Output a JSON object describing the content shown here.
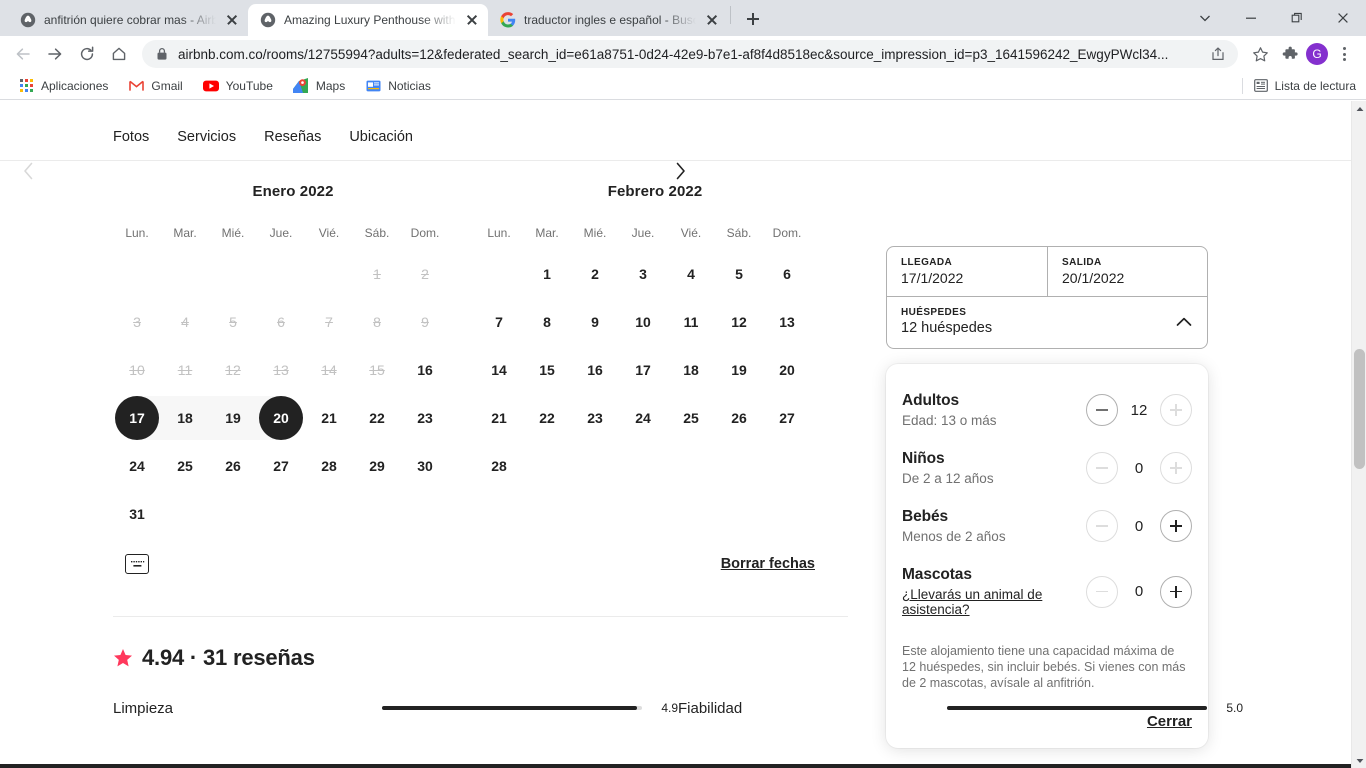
{
  "browser": {
    "tabs": [
      {
        "title": "anfitrión quiere cobrar mas - Airb",
        "favicon": "airbnb-icon",
        "active": false
      },
      {
        "title": "Amazing Luxury Penthouse with P",
        "favicon": "airbnb-icon",
        "active": true
      },
      {
        "title": "traductor ingles e español - Busc",
        "favicon": "google-icon",
        "active": false
      }
    ],
    "new_tab_label": "+",
    "window_controls": [
      "chevron-down",
      "minimize",
      "restore",
      "close"
    ],
    "nav": {
      "back": "←",
      "forward": "→",
      "reload": "⟳",
      "home": "⌂"
    },
    "omnibox": {
      "url": "airbnb.com.co/rooms/12755994?adults=12&federated_search_id=e61a8751-0d24-42e9-b7e1-af8f4d8518ec&source_impression_id=p3_1641596242_EwgyPWcl34...",
      "lock": "lock-icon"
    },
    "toolbar_icons": [
      "share-icon",
      "star-icon",
      "extensions-icon"
    ],
    "avatar_letter": "G",
    "bookmarks": [
      {
        "label": "Aplicaciones",
        "icon": "apps-grid-icon"
      },
      {
        "label": "Gmail",
        "icon": "gmail-icon"
      },
      {
        "label": "YouTube",
        "icon": "youtube-icon"
      },
      {
        "label": "Maps",
        "icon": "maps-icon"
      },
      {
        "label": "Noticias",
        "icon": "news-icon"
      }
    ],
    "reading_list": {
      "label": "Lista de lectura",
      "icon": "reading-list-icon"
    }
  },
  "page": {
    "section_nav": [
      "Fotos",
      "Servicios",
      "Reseñas",
      "Ubicación"
    ],
    "calendar": {
      "prev_label": "‹",
      "next_label": "›",
      "dow": [
        "Lun.",
        "Mar.",
        "Mié.",
        "Jue.",
        "Vié.",
        "Sáb.",
        "Dom."
      ],
      "months": [
        {
          "title": "Enero 2022",
          "lead_blanks": 5,
          "days": [
            {
              "n": 1,
              "state": "disabled"
            },
            {
              "n": 2,
              "state": "disabled"
            },
            {
              "n": 3,
              "state": "disabled"
            },
            {
              "n": 4,
              "state": "disabled"
            },
            {
              "n": 5,
              "state": "disabled"
            },
            {
              "n": 6,
              "state": "disabled"
            },
            {
              "n": 7,
              "state": "disabled"
            },
            {
              "n": 8,
              "state": "disabled"
            },
            {
              "n": 9,
              "state": "disabled"
            },
            {
              "n": 10,
              "state": "disabled"
            },
            {
              "n": 11,
              "state": "disabled"
            },
            {
              "n": 12,
              "state": "disabled"
            },
            {
              "n": 13,
              "state": "disabled"
            },
            {
              "n": 14,
              "state": "disabled"
            },
            {
              "n": 15,
              "state": "disabled"
            },
            {
              "n": 16,
              "state": "available"
            },
            {
              "n": 17,
              "state": "selected-start"
            },
            {
              "n": 18,
              "state": "in-range"
            },
            {
              "n": 19,
              "state": "in-range"
            },
            {
              "n": 20,
              "state": "selected-end"
            },
            {
              "n": 21,
              "state": "available"
            },
            {
              "n": 22,
              "state": "available"
            },
            {
              "n": 23,
              "state": "available"
            },
            {
              "n": 24,
              "state": "available"
            },
            {
              "n": 25,
              "state": "available"
            },
            {
              "n": 26,
              "state": "available"
            },
            {
              "n": 27,
              "state": "available"
            },
            {
              "n": 28,
              "state": "available"
            },
            {
              "n": 29,
              "state": "available"
            },
            {
              "n": 30,
              "state": "available"
            },
            {
              "n": 31,
              "state": "available"
            }
          ]
        },
        {
          "title": "Febrero 2022",
          "lead_blanks": 1,
          "days": [
            {
              "n": 1,
              "state": "available"
            },
            {
              "n": 2,
              "state": "available"
            },
            {
              "n": 3,
              "state": "available"
            },
            {
              "n": 4,
              "state": "available"
            },
            {
              "n": 5,
              "state": "available"
            },
            {
              "n": 6,
              "state": "available"
            },
            {
              "n": 7,
              "state": "available"
            },
            {
              "n": 8,
              "state": "available"
            },
            {
              "n": 9,
              "state": "available"
            },
            {
              "n": 10,
              "state": "available"
            },
            {
              "n": 11,
              "state": "available"
            },
            {
              "n": 12,
              "state": "available"
            },
            {
              "n": 13,
              "state": "available"
            },
            {
              "n": 14,
              "state": "available"
            },
            {
              "n": 15,
              "state": "available"
            },
            {
              "n": 16,
              "state": "available"
            },
            {
              "n": 17,
              "state": "available"
            },
            {
              "n": 18,
              "state": "available"
            },
            {
              "n": 19,
              "state": "available"
            },
            {
              "n": 20,
              "state": "available"
            },
            {
              "n": 21,
              "state": "available"
            },
            {
              "n": 22,
              "state": "available"
            },
            {
              "n": 23,
              "state": "available"
            },
            {
              "n": 24,
              "state": "available"
            },
            {
              "n": 25,
              "state": "available"
            },
            {
              "n": 26,
              "state": "available"
            },
            {
              "n": 27,
              "state": "available"
            },
            {
              "n": 28,
              "state": "available"
            }
          ]
        }
      ],
      "keyboard_icon": "keyboard-icon",
      "clear_dates_label": "Borrar fechas"
    },
    "reviews": {
      "star_icon": "star-icon",
      "rating": "4.94",
      "separator": "·",
      "count_label": "31 reseñas",
      "heading": "4.94 · 31 reseñas",
      "categories": [
        {
          "label": "Limpieza",
          "value": "4.9",
          "pct": 98
        },
        {
          "label": "Fiabilidad",
          "value": "5.0",
          "pct": 100
        }
      ]
    },
    "booking": {
      "checkin_label": "LLEGADA",
      "checkin_value": "17/1/2022",
      "checkout_label": "SALIDA",
      "checkout_value": "20/1/2022",
      "guests_label": "HUÉSPEDES",
      "guests_value": "12 huéspedes",
      "collapse_icon": "chevron-up-icon",
      "guest_types": [
        {
          "name": "Adultos",
          "sub": "Edad: 13 o más",
          "sub_is_link": false,
          "count": "12",
          "minus_disabled": false,
          "plus_disabled": true
        },
        {
          "name": "Niños",
          "sub": "De 2 a 12 años",
          "sub_is_link": false,
          "count": "0",
          "minus_disabled": true,
          "plus_disabled": true
        },
        {
          "name": "Bebés",
          "sub": "Menos de 2 años",
          "sub_is_link": false,
          "count": "0",
          "minus_disabled": true,
          "plus_disabled": false
        },
        {
          "name": "Mascotas",
          "sub": "¿Llevarás un animal de asistencia?",
          "sub_is_link": true,
          "count": "0",
          "minus_disabled": true,
          "plus_disabled": false
        }
      ],
      "capacity_note": "Este alojamiento tiene una capacidad máxima de 12 huéspedes, sin incluir bebés. Si vienes con más de 2 mascotas, avísale al anfitrión.",
      "close_label": "Cerrar"
    }
  },
  "colors": {
    "accent_pink": "#ff385c",
    "selected_day": "#222222",
    "range_band": "#f7f7f7",
    "chrome_bg": "#dee1e6",
    "avatar": "#8430ce"
  }
}
